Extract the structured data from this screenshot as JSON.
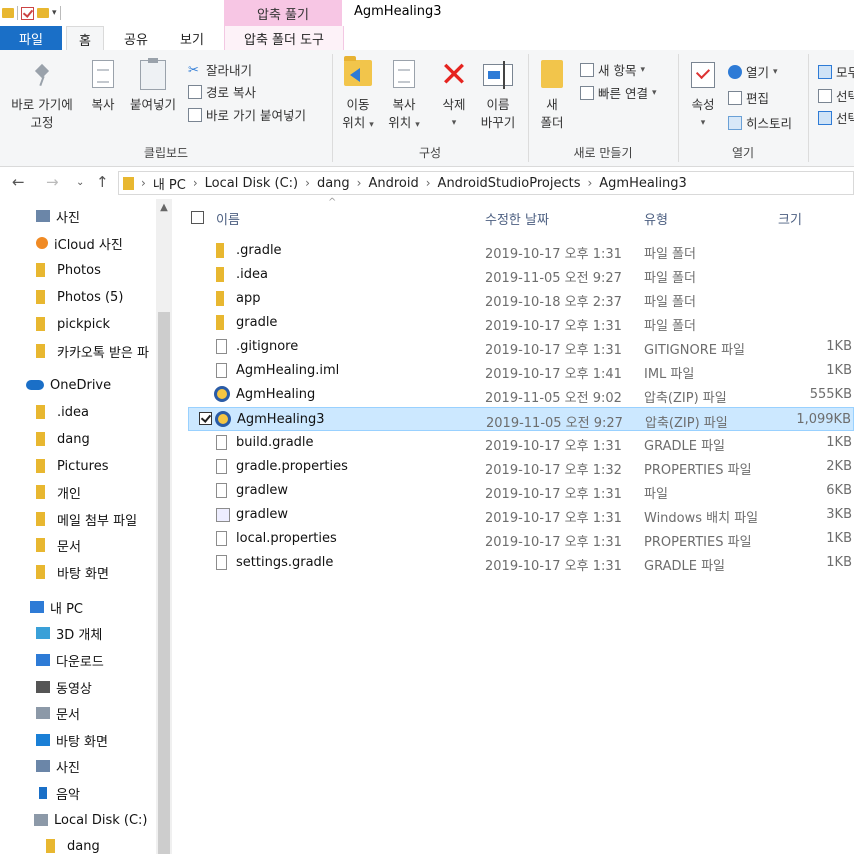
{
  "window": {
    "title": "AgmHealing3",
    "context_tab_title": "압축 풀기"
  },
  "tabs": [
    "파일",
    "홈",
    "공유",
    "보기",
    "압축 폴더 도구"
  ],
  "ribbon": {
    "clipboard": {
      "pin_label_1": "바로 가기에",
      "pin_label_2": "고정",
      "copy": "복사",
      "paste": "붙여넣기",
      "cut": "잘라내기",
      "copy_path": "경로 복사",
      "paste_shortcut": "바로 가기 붙여넣기",
      "group": "클립보드"
    },
    "organize": {
      "move_1": "이동",
      "move_2": "위치",
      "copyto_1": "복사",
      "copyto_2": "위치",
      "delete": "삭제",
      "rename_1": "이름",
      "rename_2": "바꾸기",
      "group": "구성"
    },
    "new": {
      "newfolder_1": "새",
      "newfolder_2": "폴더",
      "new_item": "새 항목",
      "easy_access": "빠른 연결",
      "group": "새로 만들기"
    },
    "open": {
      "properties": "속성",
      "open": "열기",
      "edit": "편집",
      "history": "히스토리",
      "group": "열기"
    },
    "select": {
      "select_all": "모두",
      "select_none": "선택",
      "invert": "선택"
    }
  },
  "address": {
    "crumbs": [
      "내 PC",
      "Local Disk (C:)",
      "dang",
      "Android",
      "AndroidStudioProjects",
      "AgmHealing3"
    ]
  },
  "nav": {
    "items": [
      {
        "label": "사진",
        "icon": "pictures-icon",
        "pinned": true
      },
      {
        "label": "iCloud 사진",
        "icon": "icloud-photos-icon",
        "pinned": true
      },
      {
        "label": "Photos",
        "icon": "folder-icon"
      },
      {
        "label": "Photos (5)",
        "icon": "folder-icon"
      },
      {
        "label": "pickpick",
        "icon": "folder-icon"
      },
      {
        "label": "카카오톡 받은 파",
        "icon": "folder-icon"
      },
      {
        "label": "OneDrive",
        "icon": "onedrive-icon"
      },
      {
        "label": ".idea",
        "icon": "folder-icon"
      },
      {
        "label": "dang",
        "icon": "folder-icon"
      },
      {
        "label": "Pictures",
        "icon": "folder-icon"
      },
      {
        "label": "개인",
        "icon": "folder-icon"
      },
      {
        "label": "메일 첨부 파일",
        "icon": "folder-icon"
      },
      {
        "label": "문서",
        "icon": "folder-icon"
      },
      {
        "label": "바탕 화면",
        "icon": "folder-icon"
      },
      {
        "label": "내 PC",
        "icon": "this-pc-icon"
      },
      {
        "label": "3D 개체",
        "icon": "3d-objects-icon"
      },
      {
        "label": "다운로드",
        "icon": "downloads-icon"
      },
      {
        "label": "동영상",
        "icon": "videos-icon"
      },
      {
        "label": "문서",
        "icon": "documents-icon"
      },
      {
        "label": "바탕 화면",
        "icon": "desktop-icon"
      },
      {
        "label": "사진",
        "icon": "pictures-icon"
      },
      {
        "label": "음악",
        "icon": "music-icon"
      },
      {
        "label": "Local Disk (C:)",
        "icon": "local-disk-icon"
      },
      {
        "label": "dang",
        "icon": "folder-icon"
      }
    ]
  },
  "columns": {
    "name": "이름",
    "date": "수정한 날짜",
    "type": "유형",
    "size": "크기"
  },
  "files": [
    {
      "name": ".gradle",
      "date": "2019-10-17 오후 1:31",
      "type": "파일 폴더",
      "size": "",
      "icon": "folder"
    },
    {
      "name": ".idea",
      "date": "2019-11-05 오전 9:27",
      "type": "파일 폴더",
      "size": "",
      "icon": "folder"
    },
    {
      "name": "app",
      "date": "2019-10-18 오후 2:37",
      "type": "파일 폴더",
      "size": "",
      "icon": "folder"
    },
    {
      "name": "gradle",
      "date": "2019-10-17 오후 1:31",
      "type": "파일 폴더",
      "size": "",
      "icon": "folder"
    },
    {
      "name": ".gitignore",
      "date": "2019-10-17 오후 1:31",
      "type": "GITIGNORE 파일",
      "size": "1KB",
      "icon": "file"
    },
    {
      "name": "AgmHealing.iml",
      "date": "2019-10-17 오후 1:41",
      "type": "IML 파일",
      "size": "1KB",
      "icon": "file"
    },
    {
      "name": "AgmHealing",
      "date": "2019-11-05 오전 9:02",
      "type": "압축(ZIP) 파일",
      "size": "555KB",
      "icon": "zip"
    },
    {
      "name": "AgmHealing3",
      "date": "2019-11-05 오전 9:27",
      "type": "압축(ZIP) 파일",
      "size": "1,099KB",
      "icon": "zip",
      "selected": true
    },
    {
      "name": "build.gradle",
      "date": "2019-10-17 오후 1:31",
      "type": "GRADLE 파일",
      "size": "1KB",
      "icon": "file"
    },
    {
      "name": "gradle.properties",
      "date": "2019-10-17 오후 1:32",
      "type": "PROPERTIES 파일",
      "size": "2KB",
      "icon": "file"
    },
    {
      "name": "gradlew",
      "date": "2019-10-17 오후 1:31",
      "type": "파일",
      "size": "6KB",
      "icon": "file"
    },
    {
      "name": "gradlew",
      "date": "2019-10-17 오후 1:31",
      "type": "Windows 배치 파일",
      "size": "3KB",
      "icon": "batch"
    },
    {
      "name": "local.properties",
      "date": "2019-10-17 오후 1:31",
      "type": "PROPERTIES 파일",
      "size": "1KB",
      "icon": "file"
    },
    {
      "name": "settings.gradle",
      "date": "2019-10-17 오후 1:31",
      "type": "GRADLE 파일",
      "size": "1KB",
      "icon": "file"
    }
  ],
  "colors": {
    "file_tab": "#1a6fc7",
    "context_tab": "#f7c6e4",
    "selection": "#cce8ff",
    "header_text": "#4d6082"
  }
}
